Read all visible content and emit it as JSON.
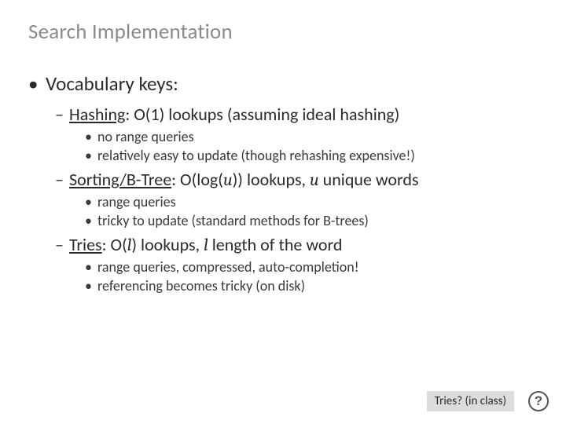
{
  "title": "Search Implementation",
  "l1_bullet": "•",
  "l1_text": "Vocabulary keys:",
  "h1_label": "Hashing",
  "h1_rest": ": O(1) lookups (assuming ideal hashing)",
  "h1_a": "no range queries",
  "h1_b": "relatively easy to update (though rehashing expensive!)",
  "h2_label": "Sorting/B-Tree",
  "h2_mid1": ": O(log(",
  "h2_u1": "u",
  "h2_mid2": ")) lookups, ",
  "h2_u2": "u",
  "h2_end": " unique words",
  "h2_a": "range queries",
  "h2_b": "tricky to update (standard methods for B-trees)",
  "h3_label": "Tries",
  "h3_mid1": ": O(",
  "h3_l1": "l",
  "h3_mid2": ") lookups, ",
  "h3_l2": "l",
  "h3_end": " length of the word",
  "h3_a": "range queries, compressed, auto-completion!",
  "h3_b": "referencing becomes tricky (on disk)",
  "footer_text": "Tries? (in class)",
  "help": "?",
  "dash": "–",
  "dot": "•"
}
